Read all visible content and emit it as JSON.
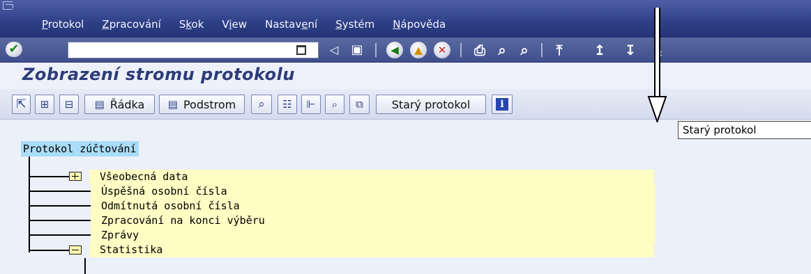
{
  "menubar": {
    "items": [
      {
        "label": "Protokol",
        "accel_index": 0
      },
      {
        "label": "Zpracování",
        "accel_index": 0
      },
      {
        "label": "Skok",
        "accel_index": 1
      },
      {
        "label": "View",
        "accel_index": 1
      },
      {
        "label": "Nastavení",
        "accel_index": 6
      },
      {
        "label": "Systém",
        "accel_index": 0
      },
      {
        "label": "Nápověda",
        "accel_index": 0
      }
    ]
  },
  "system_toolbar": {
    "command_value": "",
    "icons": [
      "enter-icon",
      "command-field-icon",
      "back-nav-icon",
      "save-icon",
      "back-icon",
      "exit-icon",
      "cancel-icon",
      "print-icon",
      "find-icon",
      "find-next-icon",
      "first-page-icon",
      "previous-page-icon",
      "next-page-icon",
      "last-page-icon"
    ]
  },
  "page": {
    "title": "Zobrazení stromu protokolu"
  },
  "app_toolbar": {
    "radka_label": "Řádka",
    "podstrom_label": "Podstrom",
    "stary_protokol_label": "Starý protokol"
  },
  "tooltip": {
    "text": "Starý protokol"
  },
  "tree": {
    "root": "Protokol zúčtování",
    "children": [
      {
        "label": "Všeobecná data",
        "folder": "collapsed"
      },
      {
        "label": "Úspěšná osobní čísla"
      },
      {
        "label": "Odmítnutá osobní čísla"
      },
      {
        "label": "Zpracování na konci výběru"
      },
      {
        "label": "Zprávy"
      },
      {
        "label": "Statistika",
        "folder": "expanded"
      }
    ]
  },
  "colors": {
    "menubar": "#2e3f86",
    "title": "#2d3c7a",
    "root_highlight": "#a9dcf6",
    "row_highlight": "#fffdc4",
    "content_bg": "#ecf0f9"
  }
}
